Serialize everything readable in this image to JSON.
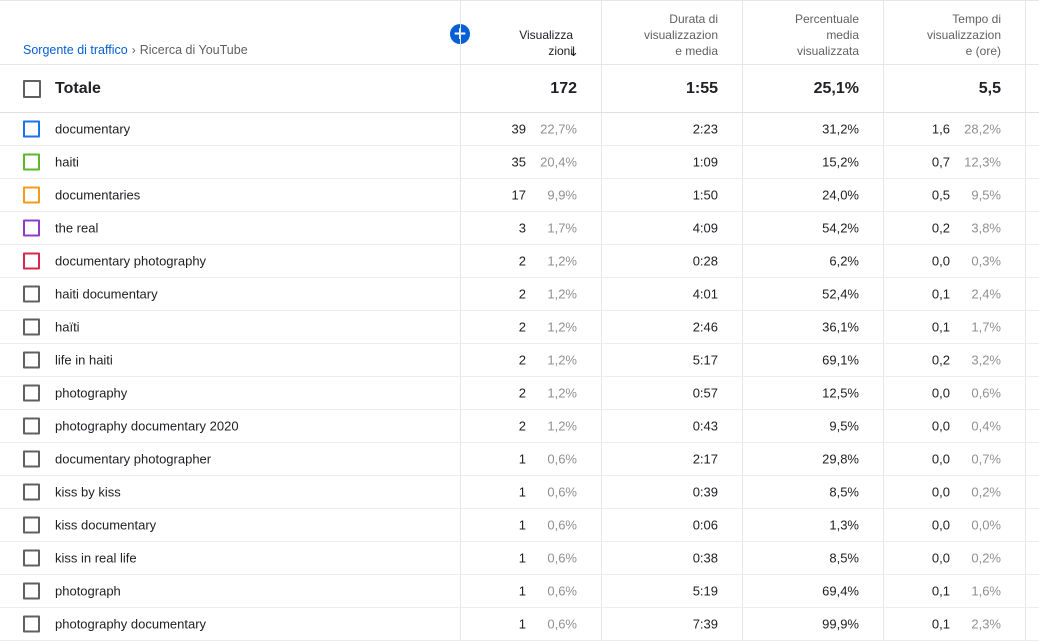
{
  "header": {
    "breadcrumb_link": "Sorgente di traffico",
    "breadcrumb_sep": "›",
    "breadcrumb_current": "Ricerca di YouTube",
    "add_metric_icon": "plus-circle-icon",
    "columns": {
      "views": "Visualizza\nzioni",
      "avg_duration": "Durata di\nvisualizzazion\ne media",
      "avg_percent": "Percentuale\nmedia\nvisualizzata",
      "watch_time": "Tempo di\nvisualizzazion\ne (ore)"
    },
    "sort_arrow": "↓"
  },
  "total": {
    "label": "Totale",
    "views": "172",
    "avg_duration": "1:55",
    "avg_percent": "25,1%",
    "watch_time": "5,5"
  },
  "rows": [
    {
      "term": "documentary",
      "cb_color": "#1a73e8",
      "views": "39",
      "views_pct": "22,7%",
      "duration": "2:23",
      "percent": "31,2%",
      "hours": "1,6",
      "hours_pct": "28,2%"
    },
    {
      "term": "haiti",
      "cb_color": "#5cb82a",
      "views": "35",
      "views_pct": "20,4%",
      "duration": "1:09",
      "percent": "15,2%",
      "hours": "0,7",
      "hours_pct": "12,3%"
    },
    {
      "term": "documentaries",
      "cb_color": "#f29b1d",
      "views": "17",
      "views_pct": "9,9%",
      "duration": "1:50",
      "percent": "24,0%",
      "hours": "0,5",
      "hours_pct": "9,5%"
    },
    {
      "term": "the real",
      "cb_color": "#8e3cc6",
      "views": "3",
      "views_pct": "1,7%",
      "duration": "4:09",
      "percent": "54,2%",
      "hours": "0,2",
      "hours_pct": "3,8%"
    },
    {
      "term": "documentary photography",
      "cb_color": "#d6284a",
      "views": "2",
      "views_pct": "1,2%",
      "duration": "0:28",
      "percent": "6,2%",
      "hours": "0,0",
      "hours_pct": "0,3%"
    },
    {
      "term": "haiti documentary",
      "cb_color": "#606060",
      "views": "2",
      "views_pct": "1,2%",
      "duration": "4:01",
      "percent": "52,4%",
      "hours": "0,1",
      "hours_pct": "2,4%"
    },
    {
      "term": "haïti",
      "cb_color": "#606060",
      "views": "2",
      "views_pct": "1,2%",
      "duration": "2:46",
      "percent": "36,1%",
      "hours": "0,1",
      "hours_pct": "1,7%"
    },
    {
      "term": "life in haiti",
      "cb_color": "#606060",
      "views": "2",
      "views_pct": "1,2%",
      "duration": "5:17",
      "percent": "69,1%",
      "hours": "0,2",
      "hours_pct": "3,2%"
    },
    {
      "term": "photography",
      "cb_color": "#606060",
      "views": "2",
      "views_pct": "1,2%",
      "duration": "0:57",
      "percent": "12,5%",
      "hours": "0,0",
      "hours_pct": "0,6%"
    },
    {
      "term": "photography documentary 2020",
      "cb_color": "#606060",
      "views": "2",
      "views_pct": "1,2%",
      "duration": "0:43",
      "percent": "9,5%",
      "hours": "0,0",
      "hours_pct": "0,4%"
    },
    {
      "term": "documentary photographer",
      "cb_color": "#606060",
      "views": "1",
      "views_pct": "0,6%",
      "duration": "2:17",
      "percent": "29,8%",
      "hours": "0,0",
      "hours_pct": "0,7%"
    },
    {
      "term": "kiss by kiss",
      "cb_color": "#606060",
      "views": "1",
      "views_pct": "0,6%",
      "duration": "0:39",
      "percent": "8,5%",
      "hours": "0,0",
      "hours_pct": "0,2%"
    },
    {
      "term": "kiss documentary",
      "cb_color": "#606060",
      "views": "1",
      "views_pct": "0,6%",
      "duration": "0:06",
      "percent": "1,3%",
      "hours": "0,0",
      "hours_pct": "0,0%"
    },
    {
      "term": "kiss in real life",
      "cb_color": "#606060",
      "views": "1",
      "views_pct": "0,6%",
      "duration": "0:38",
      "percent": "8,5%",
      "hours": "0,0",
      "hours_pct": "0,2%"
    },
    {
      "term": "photograph",
      "cb_color": "#606060",
      "views": "1",
      "views_pct": "0,6%",
      "duration": "5:19",
      "percent": "69,4%",
      "hours": "0,1",
      "hours_pct": "1,6%"
    },
    {
      "term": "photography documentary",
      "cb_color": "#606060",
      "views": "1",
      "views_pct": "0,6%",
      "duration": "7:39",
      "percent": "99,9%",
      "hours": "0,1",
      "hours_pct": "2,3%"
    }
  ]
}
